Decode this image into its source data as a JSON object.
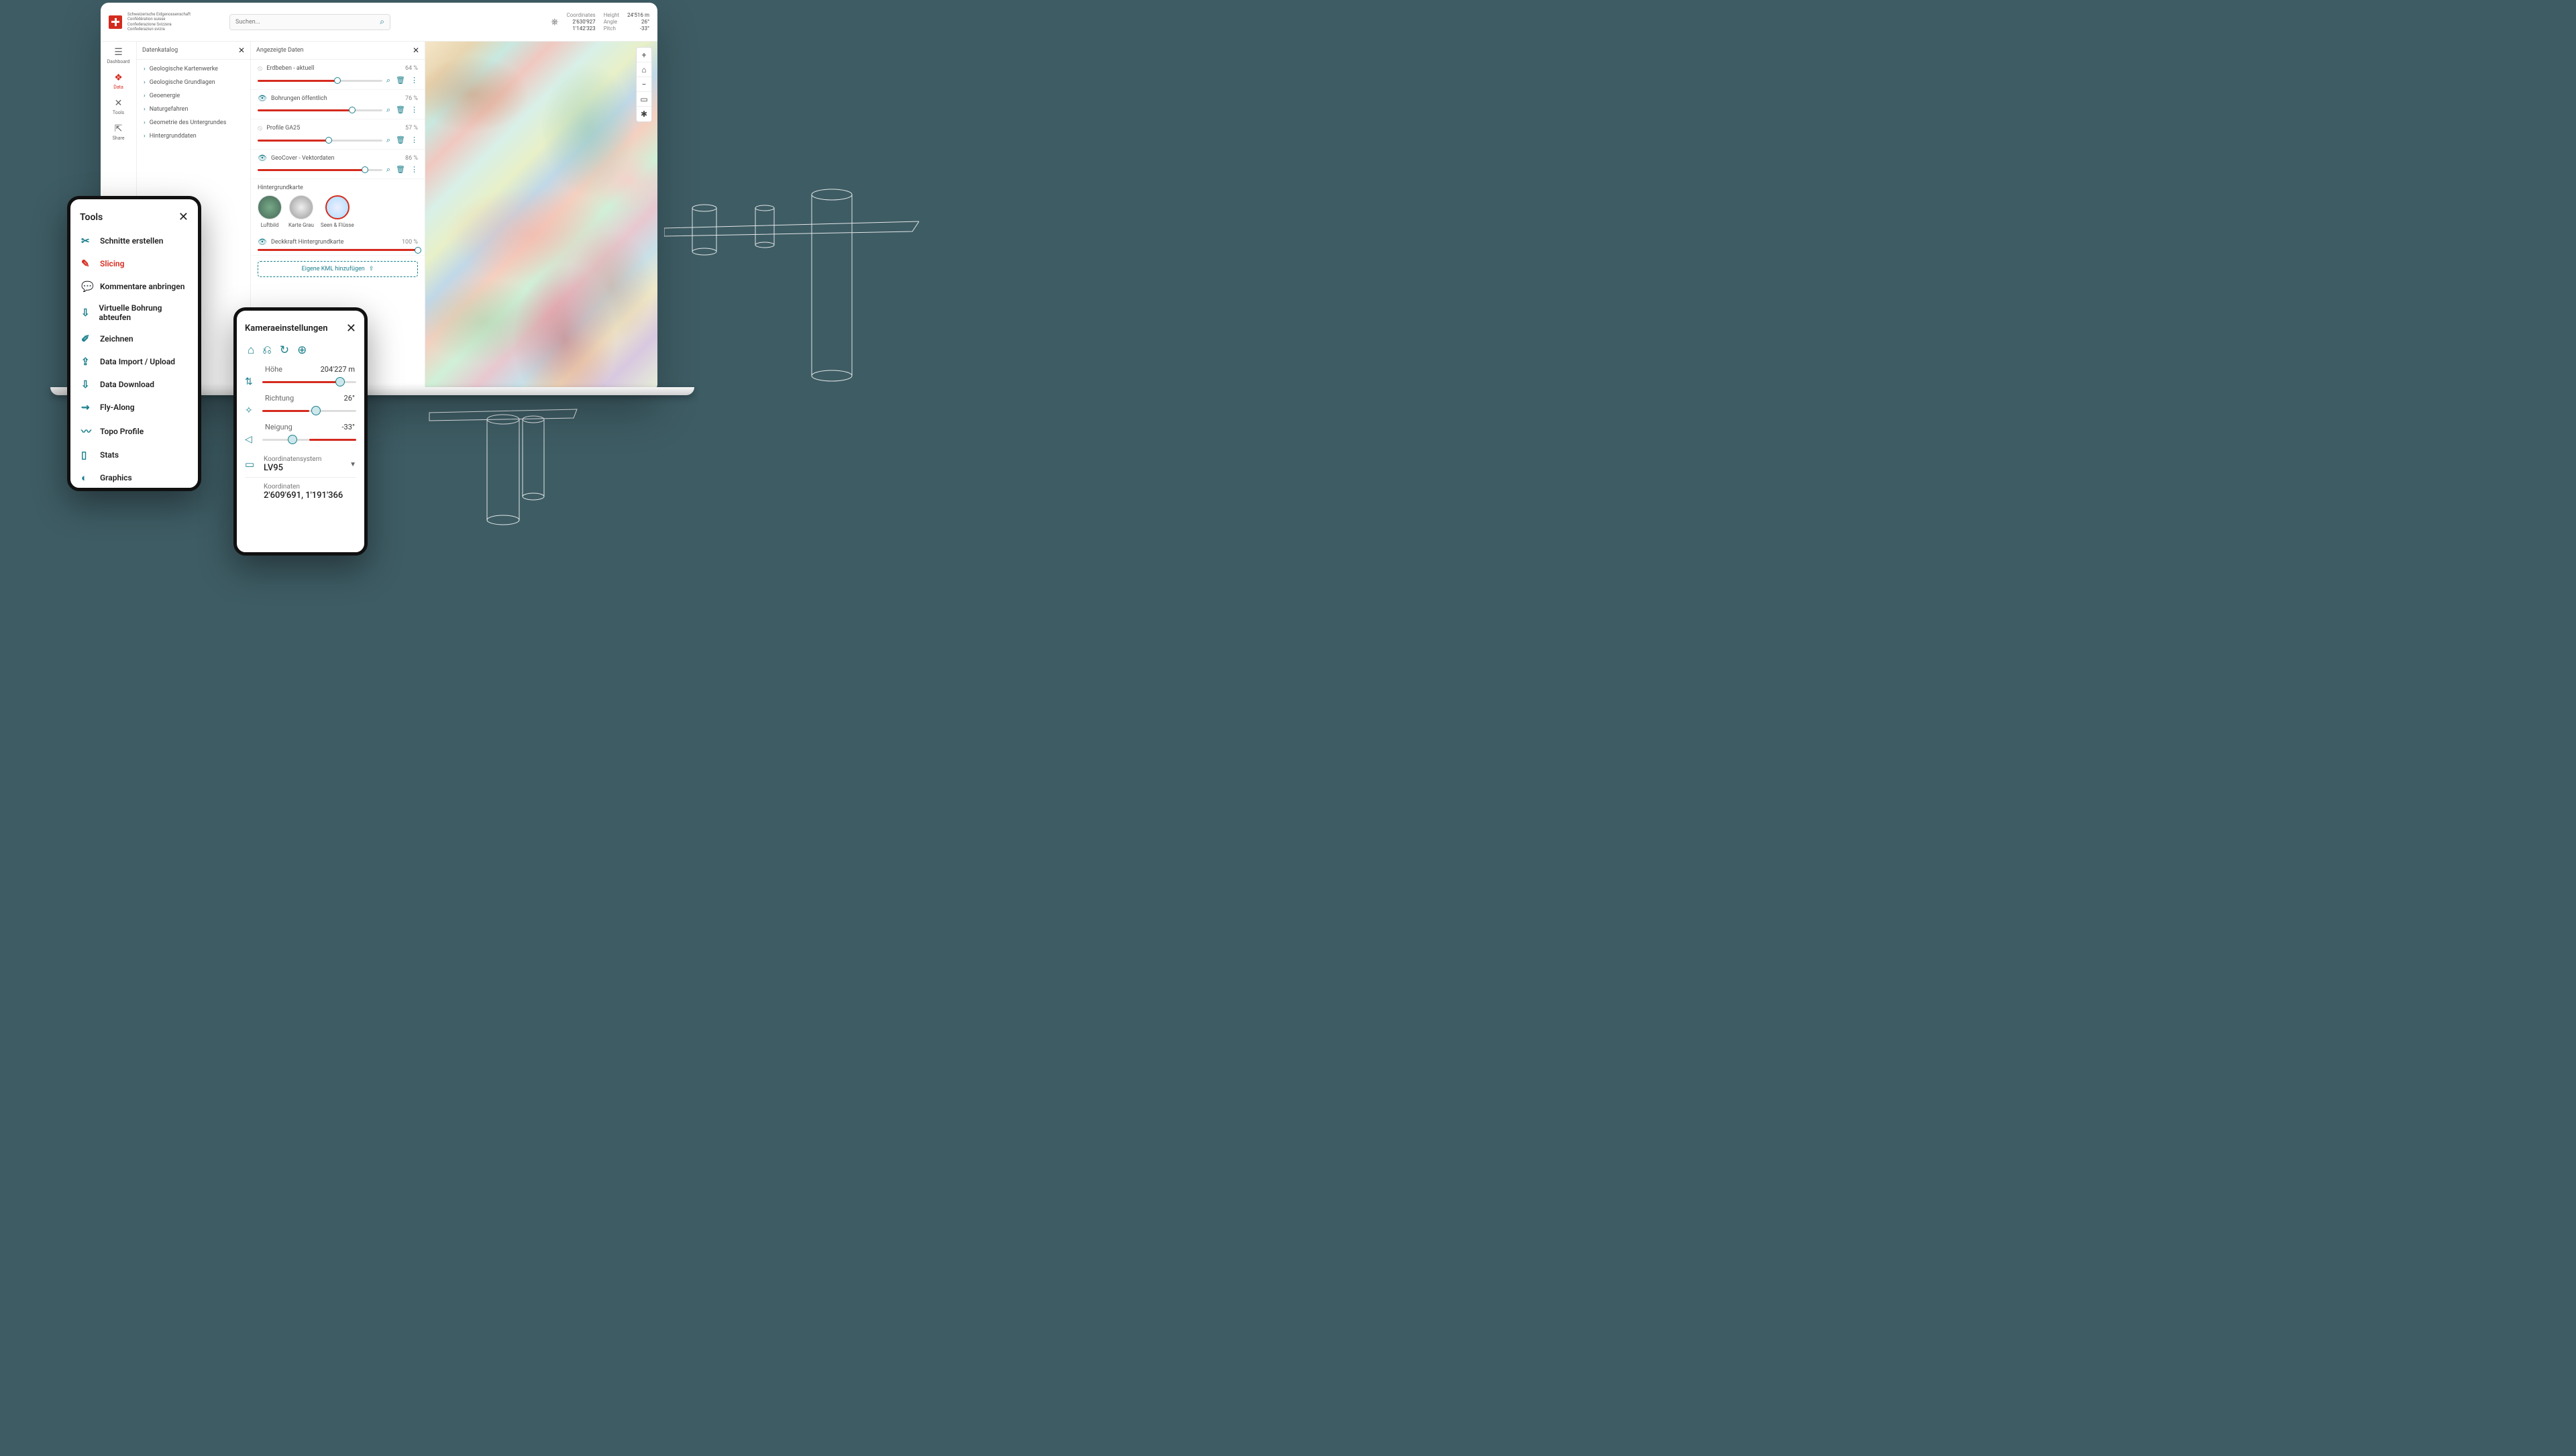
{
  "header": {
    "confederation": "Schweizerische Eidgenossenschaft\nConfédération suisse\nConfederazione Svizzera\nConfederaziun svizra",
    "search_placeholder": "Suchen...",
    "coords": {
      "labels": {
        "coords": "Coordinates",
        "height": "Height",
        "angle": "Angle",
        "pitch": "Pitch"
      },
      "east": "2'630'927",
      "north": "1'142'323",
      "height": "24'516 m",
      "angle": "26°",
      "pitch": "-33°"
    }
  },
  "nav": {
    "dashboard": "Dashboard",
    "data": "Data",
    "tools": "Tools",
    "share": "Share"
  },
  "catalog": {
    "title": "Datenkatalog",
    "items": [
      "Geologische Kartenwerke",
      "Geologische Grundlagen",
      "Geoenergie",
      "Naturgefahren",
      "Geometrie des Untergrundes",
      "Hintergrunddaten"
    ]
  },
  "displayed": {
    "title": "Angezeigte Daten",
    "layers": [
      {
        "name": "Erdbeben - aktuell",
        "pct": "64 %",
        "p": 64,
        "eye": false
      },
      {
        "name": "Bohrungen öffentlich",
        "pct": "76 %",
        "p": 76,
        "eye": true
      },
      {
        "name": "Profile GA25",
        "pct": "57 %",
        "p": 57,
        "eye": false
      },
      {
        "name": "GeoCover - Vektordaten",
        "pct": "86 %",
        "p": 86,
        "eye": true
      }
    ],
    "bg_title": "Hintergrundkarte",
    "bg_options": [
      {
        "label": "Luftbild"
      },
      {
        "label": "Karte Grau"
      },
      {
        "label": "Seen & Flüsse"
      }
    ],
    "bg_opacity": {
      "label": "Deckkraft Hintergrundkarte",
      "pct": "100 %",
      "p": 100
    },
    "kml": "Eigene KML hinzufügen"
  },
  "tools_panel": {
    "title": "Tools",
    "items": [
      {
        "label": "Schnitte erstellen",
        "icon": "✂"
      },
      {
        "label": "Slicing",
        "icon": "✎",
        "active": true
      },
      {
        "label": "Kommentare anbringen",
        "icon": "💬"
      },
      {
        "label": "Virtuelle Bohrung abteufen",
        "icon": "⇩"
      },
      {
        "label": "Zeichnen",
        "icon": "✐"
      },
      {
        "label": "Data Import / Upload",
        "icon": "⇪"
      },
      {
        "label": "Data Download",
        "icon": "⇩"
      },
      {
        "label": "Fly-Along",
        "icon": "⇝"
      },
      {
        "label": "Topo Profile",
        "icon": "〰"
      },
      {
        "label": "Stats",
        "icon": "▯"
      },
      {
        "label": "Graphics",
        "icon": "◐"
      }
    ]
  },
  "camera": {
    "title": "Kameraeinstellungen",
    "height": {
      "label": "Höhe",
      "value": "204'227 m",
      "p": 83
    },
    "direction": {
      "label": "Richtung",
      "value": "26°",
      "p": 57
    },
    "tilt": {
      "label": "Neigung",
      "value": "-33°",
      "p": 32
    },
    "crs": {
      "label": "Koordinatensystem",
      "value": "LV95"
    },
    "coords": {
      "label": "Koordinaten",
      "value": "2'609'691, 1'191'366"
    }
  }
}
